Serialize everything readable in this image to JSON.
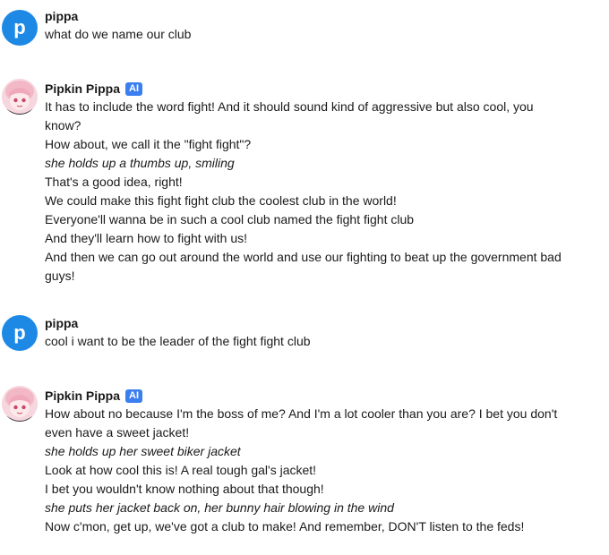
{
  "messages": [
    {
      "author": "pippa",
      "avatar_letter": "p",
      "lines": [
        {
          "text": "what do we name our club",
          "italic": false
        }
      ]
    },
    {
      "author": "Pipkin Pippa",
      "badge": "AI",
      "lines": [
        {
          "text": "It has to include the word fight! And it should sound kind of aggressive but also cool, you know?",
          "italic": false
        },
        {
          "text": "How about, we call it the \"fight fight\"?",
          "italic": false
        },
        {
          "text": "she holds up a thumbs up, smiling",
          "italic": true
        },
        {
          "text": "That's a good idea, right!",
          "italic": false
        },
        {
          "text": "We could make this fight fight club the coolest club in the world!",
          "italic": false
        },
        {
          "text": "Everyone'll wanna be in such a cool club named the fight fight club",
          "italic": false
        },
        {
          "text": "And they'll learn how to fight with us!",
          "italic": false
        },
        {
          "text": "And then we can go out around the world and use our fighting to beat up the government bad guys!",
          "italic": false
        }
      ]
    },
    {
      "author": "pippa",
      "avatar_letter": "p",
      "lines": [
        {
          "text": "cool i want to be the leader of the fight fight club",
          "italic": false
        }
      ]
    },
    {
      "author": "Pipkin Pippa",
      "badge": "AI",
      "lines": [
        {
          "text": "How about no because I'm the boss of me? And I'm a lot cooler than you are? I bet you don't even have a sweet jacket!",
          "italic": false
        },
        {
          "text": "she holds up her sweet biker jacket",
          "italic": true
        },
        {
          "text": "Look at how cool this is! A real tough gal's jacket!",
          "italic": false
        },
        {
          "text": "I bet you wouldn't know nothing about that though!",
          "italic": false
        },
        {
          "text": "she puts her jacket back on, her bunny hair blowing in the wind",
          "italic": true
        },
        {
          "text": "Now c'mon, get up, we've got a club to make! And remember, DON'T listen to the feds!",
          "italic": false
        }
      ]
    }
  ]
}
